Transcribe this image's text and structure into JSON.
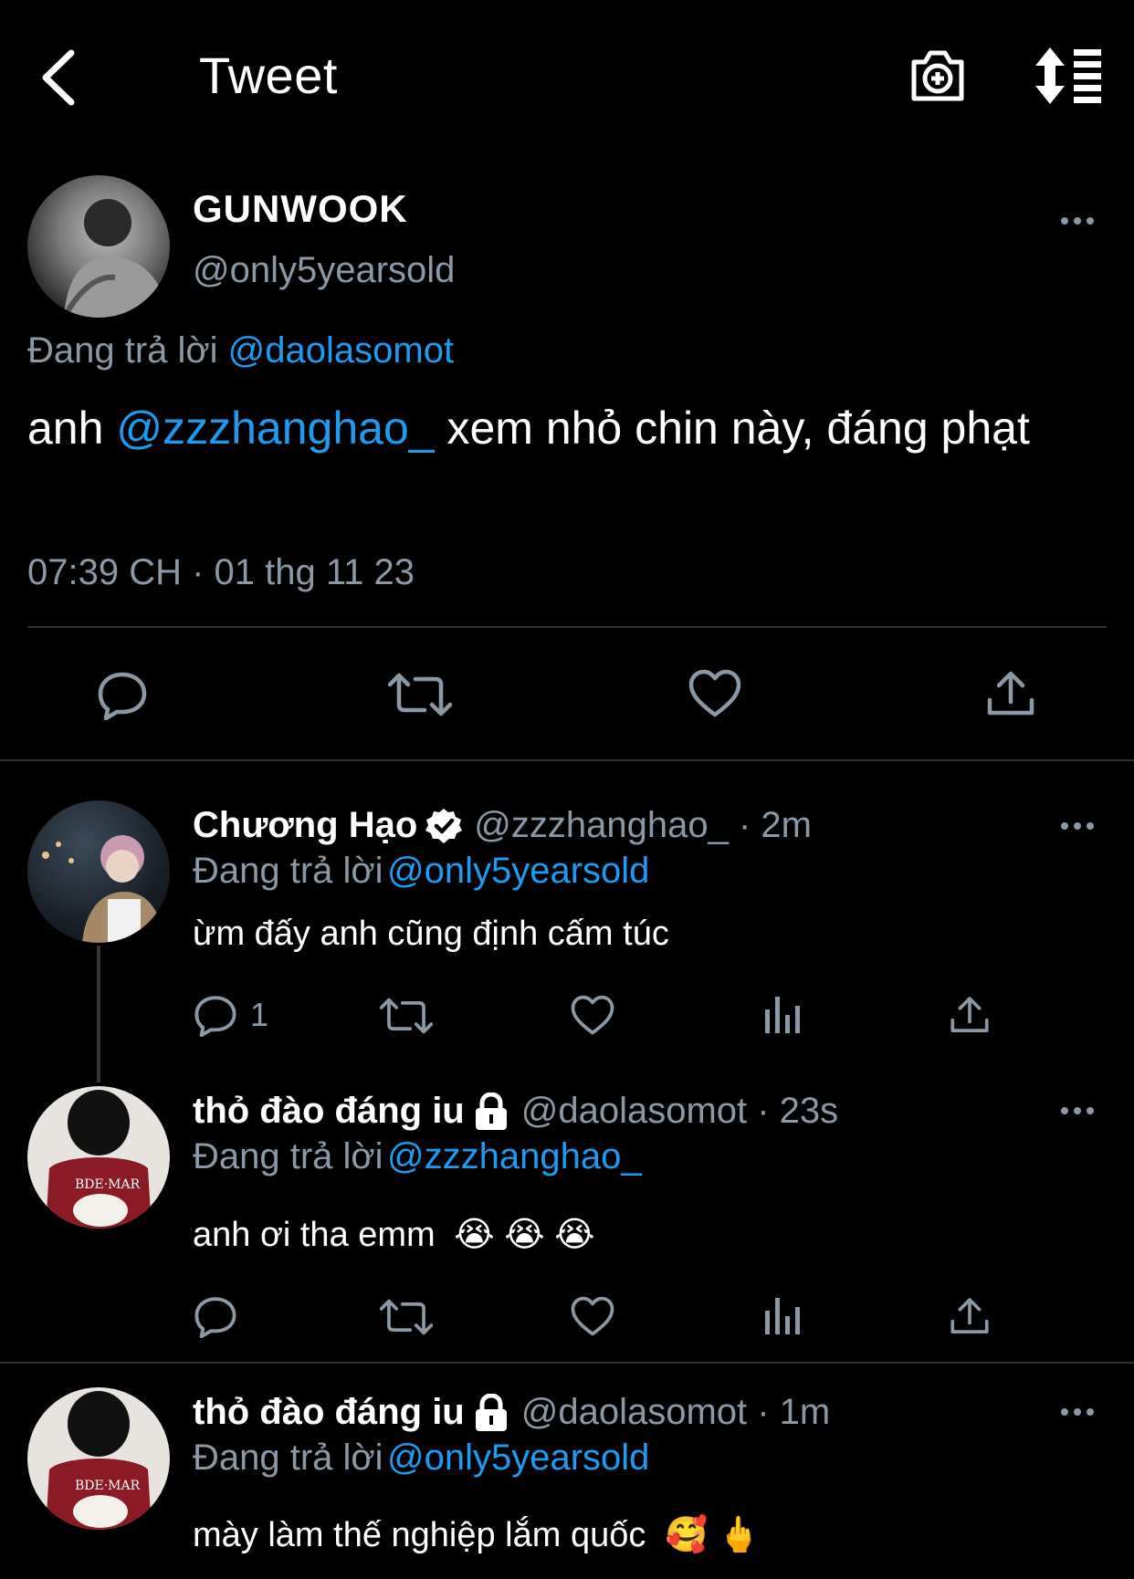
{
  "header": {
    "title": "Tweet",
    "back_icon": "chevron-left-icon",
    "camera_icon": "camera-add-icon",
    "sort_icon": "sort-list-icon"
  },
  "main_tweet": {
    "display_name": "GUNWOOK",
    "handle": "@only5yearsold",
    "reply_prefix": "Đang trả lời",
    "reply_to": "@daolasomot",
    "text_before": "anh",
    "mention": "@zzzhanghao_",
    "text_after": "xem nhỏ chin này, đáng phạt",
    "timestamp": "07:39 CH · 01 thg 11 23"
  },
  "replies": [
    {
      "display_name": "Chương Hạo",
      "verified": true,
      "handle_time": "@zzzhanghao_ · 2m",
      "reply_prefix": "Đang trả lời",
      "reply_to": "@only5yearsold",
      "text": "ừm đấy anh cũng định cấm túc",
      "reply_count": "1"
    },
    {
      "display_name": "thỏ đào đáng iu",
      "locked": true,
      "handle_time": "@daolasomot · 23s",
      "reply_prefix": "Đang trả lời",
      "reply_to": "@zzzhanghao_",
      "text": "anh ơi tha emm",
      "emoji": "😭 😭 😭",
      "reply_count": ""
    },
    {
      "display_name": "thỏ đào đáng iu",
      "locked": true,
      "handle_time": "@daolasomot · 1m",
      "reply_prefix": "Đang trả lời",
      "reply_to": "@only5yearsold",
      "text": "mày làm thế nghiệp lắm quốc",
      "emoji": "🥰 🖕"
    }
  ],
  "colors": {
    "background": "#000000",
    "text": "#ffffff",
    "muted": "#8b98a5",
    "link": "#1d9bf0",
    "separator": "#2f3336"
  }
}
